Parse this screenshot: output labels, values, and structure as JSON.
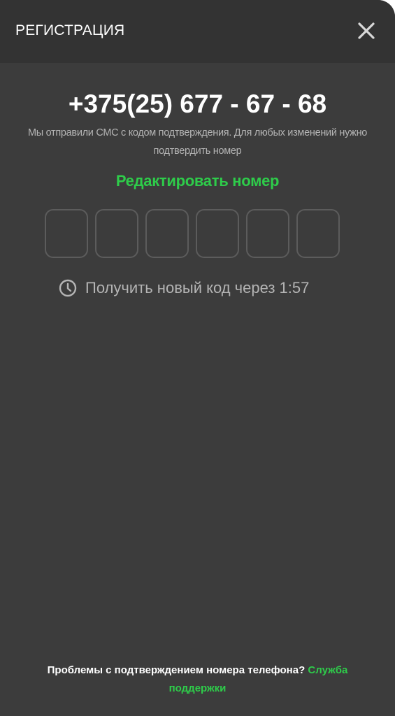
{
  "header": {
    "title": "РЕГИСТРАЦИЯ",
    "close_icon": "close-icon"
  },
  "phone": {
    "number": "+375(25) 677 - 67 - 68"
  },
  "info": {
    "text": "Мы отправили СМС с кодом подтверждения. Для любых изменений нужно подтвердить номер"
  },
  "edit": {
    "label": "Редактировать номер"
  },
  "code_inputs": {
    "values": [
      "",
      "",
      "",
      "",
      "",
      ""
    ]
  },
  "timer": {
    "icon": "clock-icon",
    "text": "Получить новый код через 1:57"
  },
  "footer": {
    "text": "Проблемы с подтверждением номера телефона?",
    "link_label": "Служба поддержки"
  },
  "colors": {
    "background": "#3c3c3c",
    "header": "#333333",
    "accent": "#2ecc4a",
    "muted_text": "#b4b4b4",
    "box_border": "#5c5c5c"
  }
}
